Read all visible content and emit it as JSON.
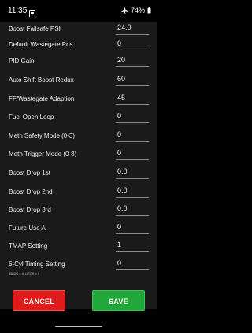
{
  "status_bar": {
    "time": "11:35",
    "battery_percent": "74%",
    "icons": [
      "app-notification-icon",
      "airplane-mode-icon",
      "battery-icon"
    ]
  },
  "settings": [
    {
      "label": "Boost Failsafe PSI",
      "value": "24.0"
    },
    {
      "label": "Default Wastegate Pos",
      "value": "0"
    },
    {
      "label": "PID Gain",
      "value": "20"
    },
    {
      "label": "Auto Shift Boost Redux",
      "value": "60"
    },
    {
      "label": "FF/Wastegate Adaption",
      "value": "45"
    },
    {
      "label": "Fuel Open Loop",
      "value": "0"
    },
    {
      "label": "Meth Safety Mode (0-3)",
      "value": "0"
    },
    {
      "label": "Meth Trigger Mode (0-3)",
      "value": "0"
    },
    {
      "label": "Boost Drop 1st",
      "value": "0.0"
    },
    {
      "label": "Boost Drop 2nd",
      "value": "0.0"
    },
    {
      "label": "Boost Drop 3rd",
      "value": "0.0"
    },
    {
      "label": "Future Use A",
      "value": "0"
    },
    {
      "label": "TMAP Setting",
      "value": "1"
    },
    {
      "label": "6-Cyl Timing Setting",
      "value": "0"
    }
  ],
  "footnote": "IBADS = 4, UEOS = 5",
  "actions": {
    "cancel_label": "CANCEL",
    "save_label": "SAVE"
  },
  "colors": {
    "cancel": "#e01b1b",
    "save": "#22a83a",
    "panel_background": "#1a1a1a"
  }
}
